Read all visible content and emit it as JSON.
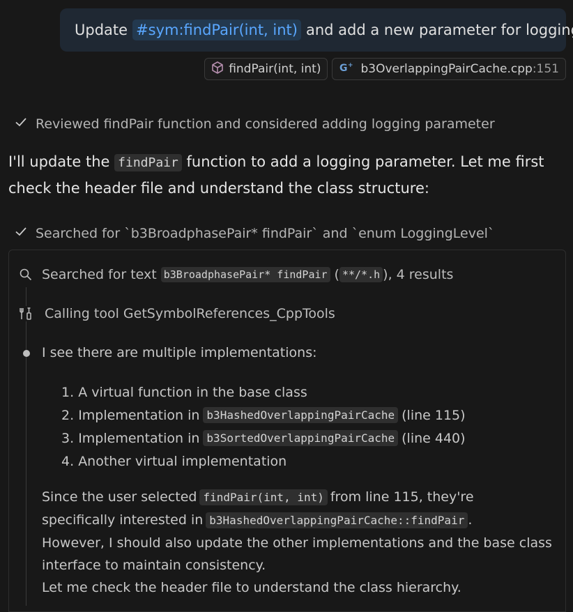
{
  "user_message": {
    "prefix": "Update",
    "symbol": "#sym:findPair(int, int)",
    "suffix": "and add a new parameter for logging"
  },
  "references": [
    {
      "icon": "symbol-icon",
      "label": "findPair(int, int)"
    },
    {
      "icon": "cpp-file-icon",
      "label": "b3OverlappingPairCache.cpp",
      "line": ":151"
    }
  ],
  "steps": {
    "reviewed": "Reviewed findPair function and considered adding logging parameter",
    "searched": "Searched for `b3BroadphasePair* findPair` and `enum LoggingLevel`"
  },
  "intro": {
    "part1": "I'll update the",
    "code": "findPair",
    "part2": "function to add a logging parameter. Let me first check the header file and understand the class structure:"
  },
  "tool_calls": {
    "search_prefix": "Searched for text",
    "search_code": "b3BroadphasePair* findPair",
    "search_open": "(",
    "search_glob": "**/*.h",
    "search_suffix": "), 4 results",
    "calling": "Calling tool GetSymbolReferences_CppTools"
  },
  "thinking": {
    "lead": "I see there are multiple implementations:",
    "items": [
      {
        "num": "1.",
        "text": "A virtual function in the base class",
        "code": "",
        "after": ""
      },
      {
        "num": "2.",
        "text": "Implementation in",
        "code": "b3HashedOverlappingPairCache",
        "after": "(line 115)"
      },
      {
        "num": "3.",
        "text": "Implementation in",
        "code": "b3SortedOverlappingPairCache",
        "after": "(line 440)"
      },
      {
        "num": "4.",
        "text": "Another virtual implementation",
        "code": "",
        "after": ""
      }
    ],
    "since1": "Since the user selected",
    "since_code": "findPair(int, int)",
    "since2": "from line 115, they're",
    "spec1": "specifically interested in",
    "spec_code": "b3HashedOverlappingPairCache::findPair",
    "spec2": ".",
    "however": "However, I should also update the other implementations and the base class",
    "interface": "interface to maintain consistency.",
    "letme": "Let me check the header file to understand the class hierarchy."
  },
  "colors": {
    "background": "#181818",
    "accent": "#5aa7ff",
    "bubble": "#1f2833"
  }
}
